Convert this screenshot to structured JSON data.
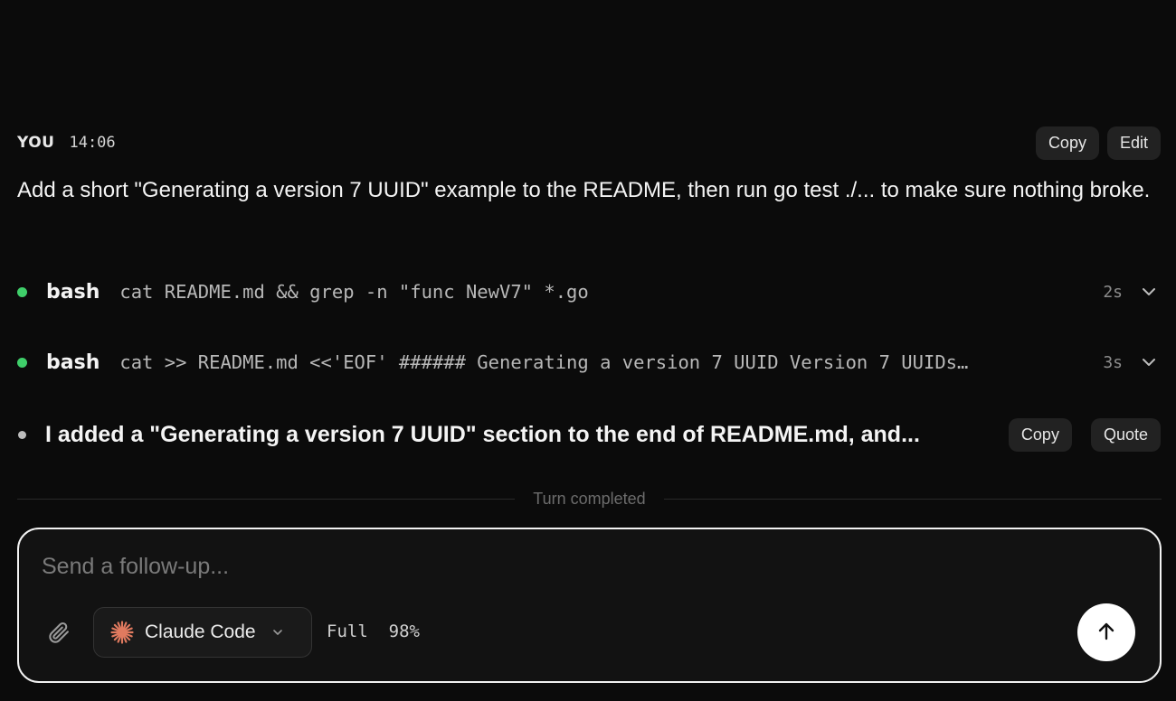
{
  "message": {
    "author": "YOU",
    "time": "14:06",
    "copy_label": "Copy",
    "edit_label": "Edit",
    "text": "Add a short \"Generating a version 7 UUID\" example to the README, then run go test ./... to make sure nothing broke."
  },
  "tool_calls": [
    {
      "name": "bash",
      "command": "cat README.md && grep -n \"func NewV7\" *.go",
      "duration": "2s",
      "status_color": "#3fcf6a"
    },
    {
      "name": "bash",
      "command": "cat >> README.md <<'EOF' ###### Generating a version 7 UUID Version 7 UUIDs…",
      "duration": "3s",
      "status_color": "#3fcf6a"
    }
  ],
  "summary": {
    "text": "I added a \"Generating a version 7 UUID\" section to the end of README.md, and...",
    "copy_label": "Copy",
    "quote_label": "Quote"
  },
  "divider": {
    "label": "Turn completed"
  },
  "composer": {
    "placeholder": "Send a follow-up...",
    "model_name": "Claude Code",
    "model_icon": "claude-sparkle-icon",
    "permission": "Full",
    "context_percent": "98%",
    "accent_color": "#e07a5f"
  }
}
